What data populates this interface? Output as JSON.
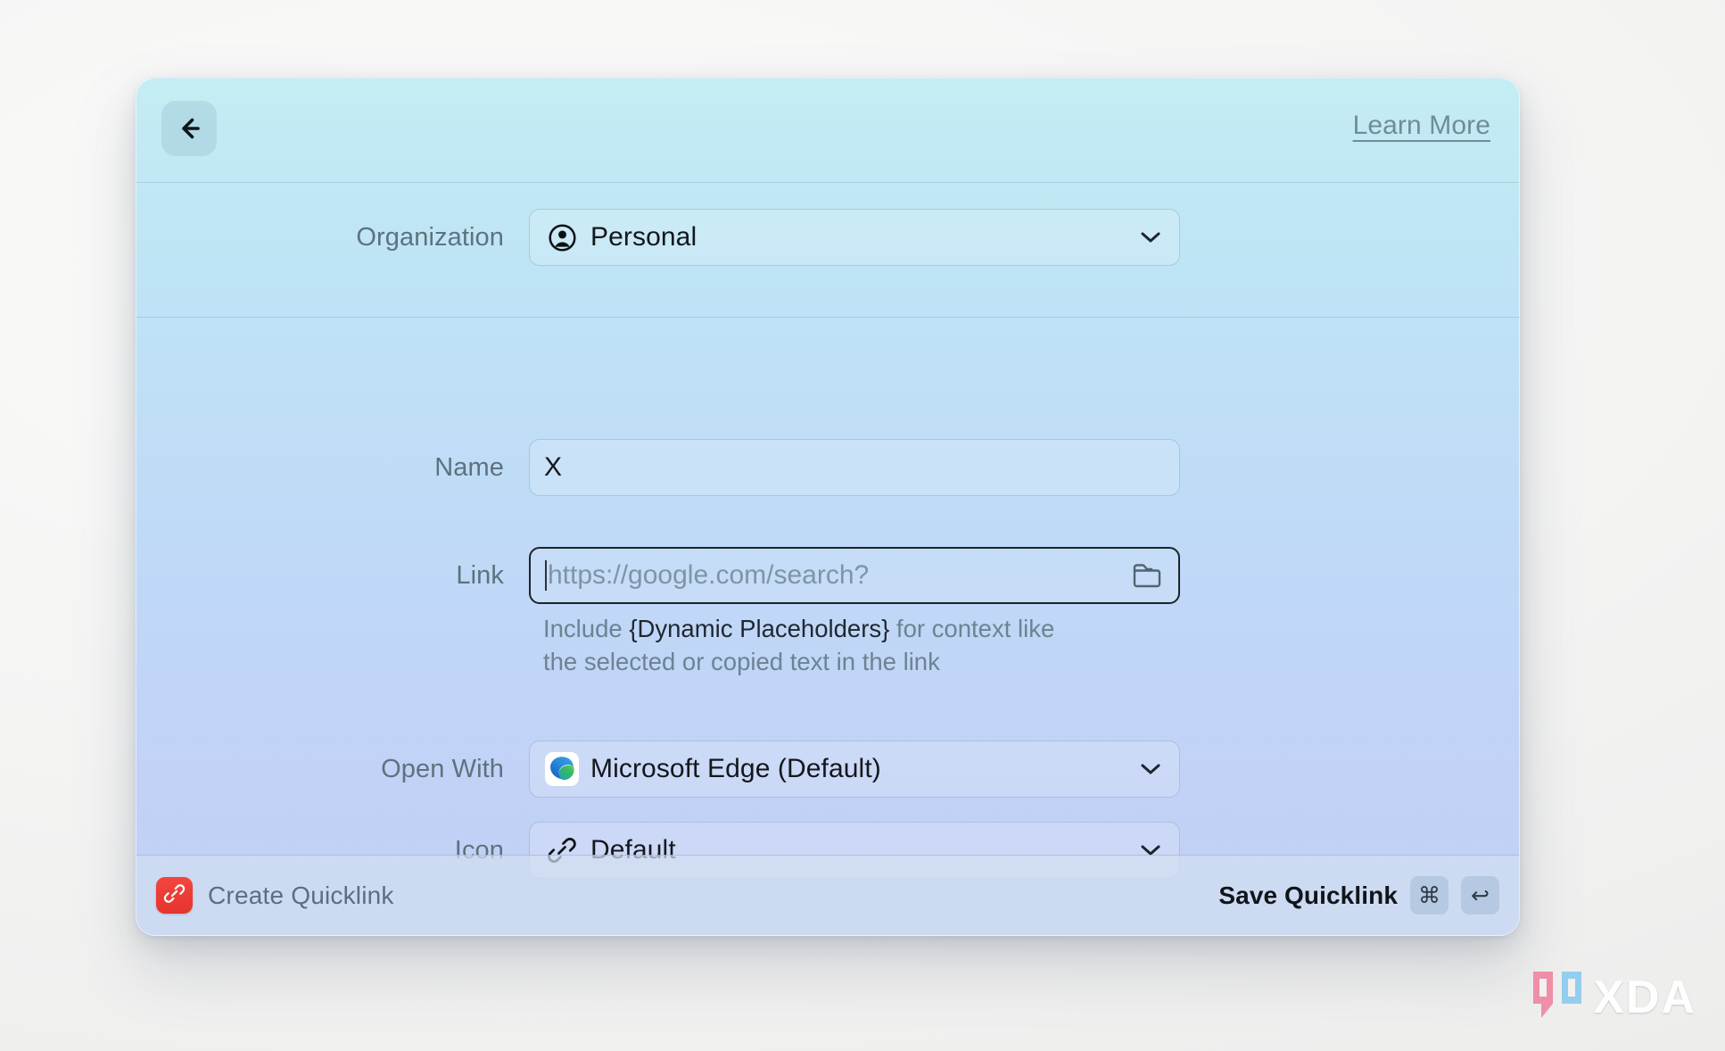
{
  "window": {
    "header": {
      "back_icon": "arrow-left-icon",
      "learn_more_label": "Learn More"
    },
    "fields": [
      {
        "label": "Organization",
        "type": "dropdown",
        "icon": "person-circle-icon",
        "value": "Personal",
        "chevron": "chevron-down-icon"
      },
      {
        "label": "Name",
        "type": "text",
        "value": "X",
        "placeholder": ""
      },
      {
        "label": "Link",
        "type": "text",
        "value": "",
        "placeholder": "https://google.com/search?",
        "focused": true,
        "trailing_icon": "folder-icon"
      },
      {
        "label": "Open With",
        "type": "dropdown",
        "icon": "microsoft-edge-icon",
        "value": "Microsoft Edge (Default)",
        "chevron": "chevron-down-icon"
      },
      {
        "label": "Icon",
        "type": "dropdown",
        "icon": "link-chain-icon",
        "value": "Default",
        "chevron": "chevron-down-icon"
      }
    ],
    "hint": {
      "prefix": "Include ",
      "highlight": "{Dynamic Placeholders}",
      "suffix": " for context like the selected or copied text in the link"
    },
    "footer": {
      "app_icon": "link-chain-icon",
      "title": "Create Quicklink",
      "save_label": "Save Quicklink",
      "keys": [
        "⌘",
        "↩"
      ]
    }
  },
  "watermark": {
    "text": "XDA",
    "bracket_left_color": "#f08aa5",
    "bracket_right_color": "#8fcdf0"
  },
  "colors": {
    "gradient_top": "#c5edf3",
    "gradient_bottom": "#c2cff5",
    "accent_red": "#e5342f",
    "label_text": "#5d727f",
    "value_text": "#14171c",
    "link_text": "#6f8d99"
  }
}
